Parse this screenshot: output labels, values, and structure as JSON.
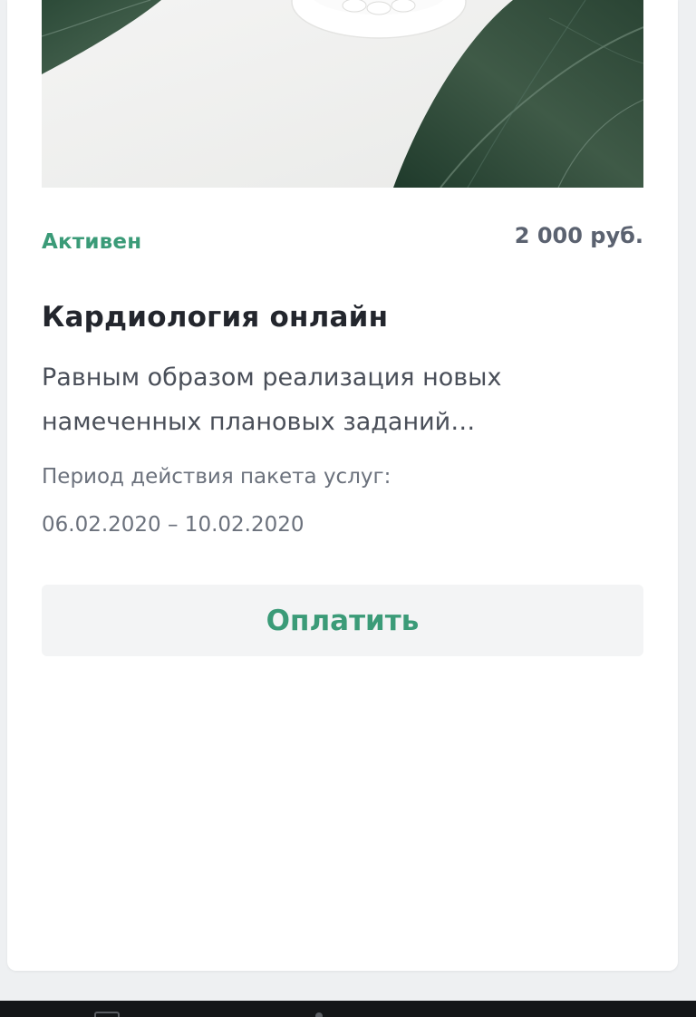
{
  "card": {
    "status": "Активен",
    "price": "2 000 руб.",
    "title": "Кардиология онлайн",
    "description": "Равным образом реализация новых намеченных плановых заданий…",
    "period_label": "Период действия пакета услуг:",
    "period_value": "06.02.2020 – 10.02.2020",
    "pay_button_label": "Оплатить"
  },
  "colors": {
    "accent_green": "#3b9b78",
    "text_dark": "#23262d",
    "text_muted": "#6b717c",
    "button_bg": "#f3f4f5"
  },
  "icons": {
    "hero_image": "pills-and-leaves-photo"
  }
}
